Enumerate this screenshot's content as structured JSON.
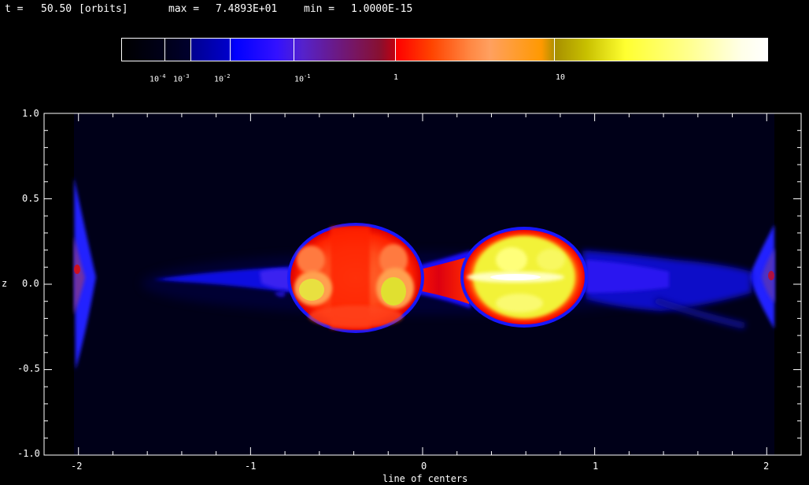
{
  "header": {
    "time_label": "t =",
    "time_value": "50.50",
    "time_unit": "[orbits]",
    "max_label": "max =",
    "max_value": "7.4893E+01",
    "min_label": "min =",
    "min_value": "1.0000E-15"
  },
  "colorbar": {
    "labels": [
      {
        "base": "10",
        "exp": "-4"
      },
      {
        "base": "10",
        "exp": "-3"
      },
      {
        "base": "10",
        "exp": "-2"
      },
      {
        "base": "10",
        "exp": "-1"
      },
      {
        "base": "1",
        "exp": ""
      },
      {
        "base": "10",
        "exp": ""
      }
    ]
  },
  "axes": {
    "xlabel": "line of centers",
    "ylabel": "z",
    "xticks": [
      "-2",
      "-1",
      "0",
      "1",
      "2"
    ],
    "yticks": [
      "1.0",
      "0.5",
      "0.0",
      "-0.5",
      "-1.0"
    ],
    "xlim": [
      -2.2,
      2.2
    ],
    "ylim": [
      -1.0,
      1.0
    ]
  }
}
